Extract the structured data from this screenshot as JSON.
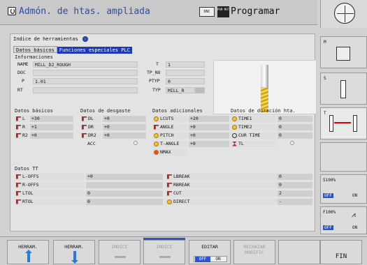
{
  "header": {
    "title": "Admón. de htas. ampliada",
    "dnc": "DNC",
    "pgm": "PGM MGT",
    "mode": "Programar"
  },
  "top": {
    "index_label": "Indice de herramientas",
    "tab1": "Datos básicos",
    "tab2": "Funciones especiales PLC"
  },
  "info": {
    "heading": "Informaciones",
    "name_label": "NAME",
    "name_value": "MILL_D2_ROUGH",
    "doc_label": "DOC",
    "doc_value": "",
    "p_label": "P",
    "p_value": "1.01",
    "rt_label": "RT",
    "rt_value": "",
    "t_label": "T",
    "t_value": "1",
    "tpno_label": "TP_NO",
    "tpno_value": "",
    "ptyp_label": "PTYP",
    "ptyp_value": "0",
    "typ_label": "TYP",
    "typ_value": "MILL_R"
  },
  "basic": {
    "heading": "Datos básicos",
    "rows": [
      {
        "l": "L",
        "v": "+30"
      },
      {
        "l": "R",
        "v": "+1"
      },
      {
        "l": "R2",
        "v": "+0"
      }
    ]
  },
  "wear": {
    "heading": "Datos de desgaste",
    "rows": [
      {
        "l": "DL",
        "v": "+0"
      },
      {
        "l": "DR",
        "v": "+0"
      },
      {
        "l": "DR2",
        "v": "+0"
      },
      {
        "l": "ACC",
        "v": ""
      }
    ]
  },
  "extra": {
    "heading": "Datos adicionales",
    "rows": [
      {
        "l": "LCUTS",
        "v": "+20"
      },
      {
        "l": "ANGLE",
        "v": "+0"
      },
      {
        "l": "PITCH",
        "v": "+0"
      },
      {
        "l": "T-ANGLE",
        "v": "+0"
      },
      {
        "l": "NMAX",
        "v": ""
      }
    ]
  },
  "life": {
    "heading": "Datos de duración hta.",
    "rows": [
      {
        "l": "TIME1",
        "v": "0"
      },
      {
        "l": "TIME2",
        "v": "0"
      },
      {
        "l": "CUR TIME",
        "v": "0"
      },
      {
        "l": "TL",
        "v": ""
      }
    ]
  },
  "tt": {
    "heading": "Datos TT",
    "left": [
      {
        "l": "L-OFFS",
        "v": "+0"
      },
      {
        "l": "R-OFFS",
        "v": ""
      },
      {
        "l": "LTOL",
        "v": "0"
      },
      {
        "l": "RTOL",
        "v": "0"
      }
    ],
    "right": [
      {
        "l": "LBREAK",
        "v": "0"
      },
      {
        "l": "RBREAK",
        "v": "0"
      },
      {
        "l": "CUT",
        "v": "2"
      },
      {
        "l": "DIRECT",
        "v": "-"
      }
    ]
  },
  "side": {
    "m": "M",
    "s": "S",
    "t": "T",
    "s100": "S100%",
    "f100": "F100%",
    "off": "OFF",
    "on": "ON"
  },
  "softkeys": {
    "k1": "HERRAM.",
    "k2": "HERRAM.",
    "k3": "INDICE",
    "k4": "INDICE",
    "k5": "EDITAR",
    "k6": "RECHAZAR MODIFIC",
    "k8": "FIN",
    "off": "OFF",
    "on": "ON"
  }
}
